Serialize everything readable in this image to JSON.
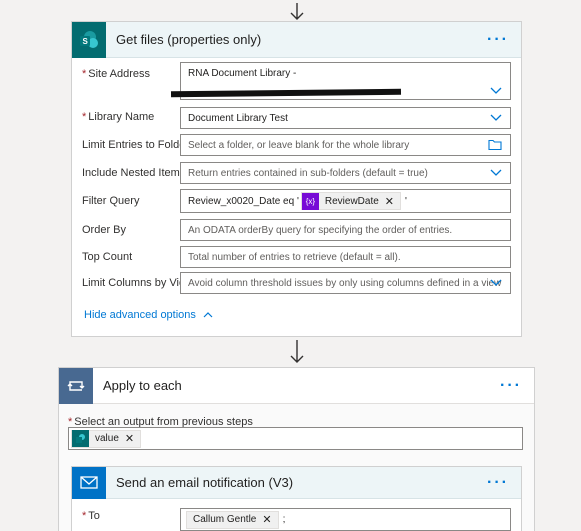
{
  "get_files": {
    "title": "Get files (properties only)",
    "menu": "···",
    "fields": {
      "site_address": {
        "label": "Site Address",
        "value": "RNA Document Library -"
      },
      "library_name": {
        "label": "Library Name",
        "value": "Document Library Test"
      },
      "limit_folder": {
        "label": "Limit Entries to Folder",
        "placeholder": "Select a folder, or leave blank for the whole library"
      },
      "nested": {
        "label": "Include Nested Items",
        "placeholder": "Return entries contained in sub-folders (default = true)"
      },
      "filter": {
        "label": "Filter Query",
        "prefix": "Review_x0020_Date eq '",
        "token": "ReviewDate",
        "token_icon": "{x}",
        "suffix": "'"
      },
      "order_by": {
        "label": "Order By",
        "placeholder": "An ODATA orderBy query for specifying the order of entries."
      },
      "top_count": {
        "label": "Top Count",
        "placeholder": "Total number of entries to retrieve (default = all)."
      },
      "limit_columns": {
        "label": "Limit Columns by View",
        "placeholder": "Avoid column threshold issues by only using columns defined in a view"
      }
    },
    "hide_advanced": "Hide advanced options"
  },
  "apply_each": {
    "title": "Apply to each",
    "menu": "···",
    "select_label": "Select an output from previous steps",
    "token": "value"
  },
  "email": {
    "title": "Send an email notification (V3)",
    "menu": "···",
    "to_label": "To",
    "to_token": "Callum Gentle",
    "to_suffix": ";"
  },
  "colors": {
    "accent": "#0078d4",
    "sharepoint": "#036c70",
    "loop": "#486991",
    "mail": "#0072c6",
    "variable": "#770bd6"
  }
}
